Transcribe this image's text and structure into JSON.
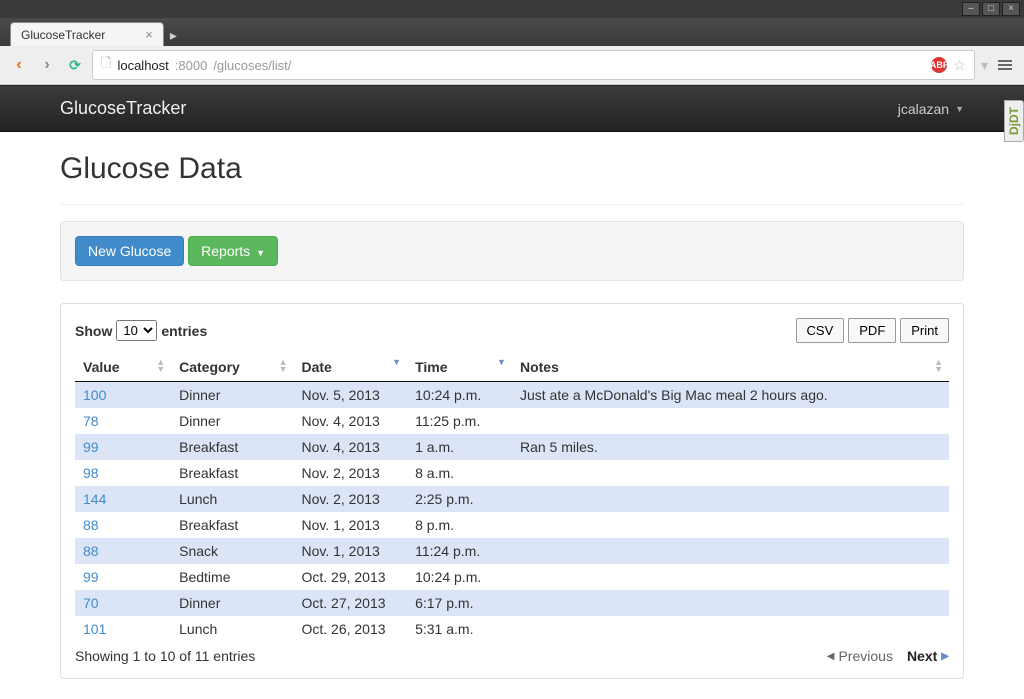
{
  "window": {
    "tab_title": "GlucoseTracker",
    "url_host": "localhost",
    "url_port": ":8000",
    "url_path": "/glucoses/list/"
  },
  "navbar": {
    "brand": "GlucoseTracker",
    "user": "jcalazan"
  },
  "page": {
    "title": "Glucose Data"
  },
  "actions": {
    "new_glucose": "New Glucose",
    "reports": "Reports"
  },
  "datatable": {
    "show_label_pre": "Show",
    "show_label_post": "entries",
    "page_size": "10",
    "export": {
      "csv": "CSV",
      "pdf": "PDF",
      "print": "Print"
    },
    "columns": [
      "Value",
      "Category",
      "Date",
      "Time",
      "Notes"
    ],
    "sorted_columns": [
      "Date",
      "Time"
    ],
    "rows": [
      {
        "value": "100",
        "category": "Dinner",
        "date": "Nov. 5, 2013",
        "time": "10:24 p.m.",
        "notes": "Just ate a McDonald's Big Mac meal 2 hours ago."
      },
      {
        "value": "78",
        "category": "Dinner",
        "date": "Nov. 4, 2013",
        "time": "11:25 p.m.",
        "notes": ""
      },
      {
        "value": "99",
        "category": "Breakfast",
        "date": "Nov. 4, 2013",
        "time": "1 a.m.",
        "notes": "Ran 5 miles."
      },
      {
        "value": "98",
        "category": "Breakfast",
        "date": "Nov. 2, 2013",
        "time": "8 a.m.",
        "notes": ""
      },
      {
        "value": "144",
        "category": "Lunch",
        "date": "Nov. 2, 2013",
        "time": "2:25 p.m.",
        "notes": ""
      },
      {
        "value": "88",
        "category": "Breakfast",
        "date": "Nov. 1, 2013",
        "time": "8 p.m.",
        "notes": ""
      },
      {
        "value": "88",
        "category": "Snack",
        "date": "Nov. 1, 2013",
        "time": "11:24 p.m.",
        "notes": ""
      },
      {
        "value": "99",
        "category": "Bedtime",
        "date": "Oct. 29, 2013",
        "time": "10:24 p.m.",
        "notes": ""
      },
      {
        "value": "70",
        "category": "Dinner",
        "date": "Oct. 27, 2013",
        "time": "6:17 p.m.",
        "notes": ""
      },
      {
        "value": "101",
        "category": "Lunch",
        "date": "Oct. 26, 2013",
        "time": "5:31 a.m.",
        "notes": ""
      }
    ],
    "info": "Showing 1 to 10 of 11 entries",
    "pager": {
      "previous": "Previous",
      "next": "Next"
    }
  },
  "side_badge": "DjDT"
}
